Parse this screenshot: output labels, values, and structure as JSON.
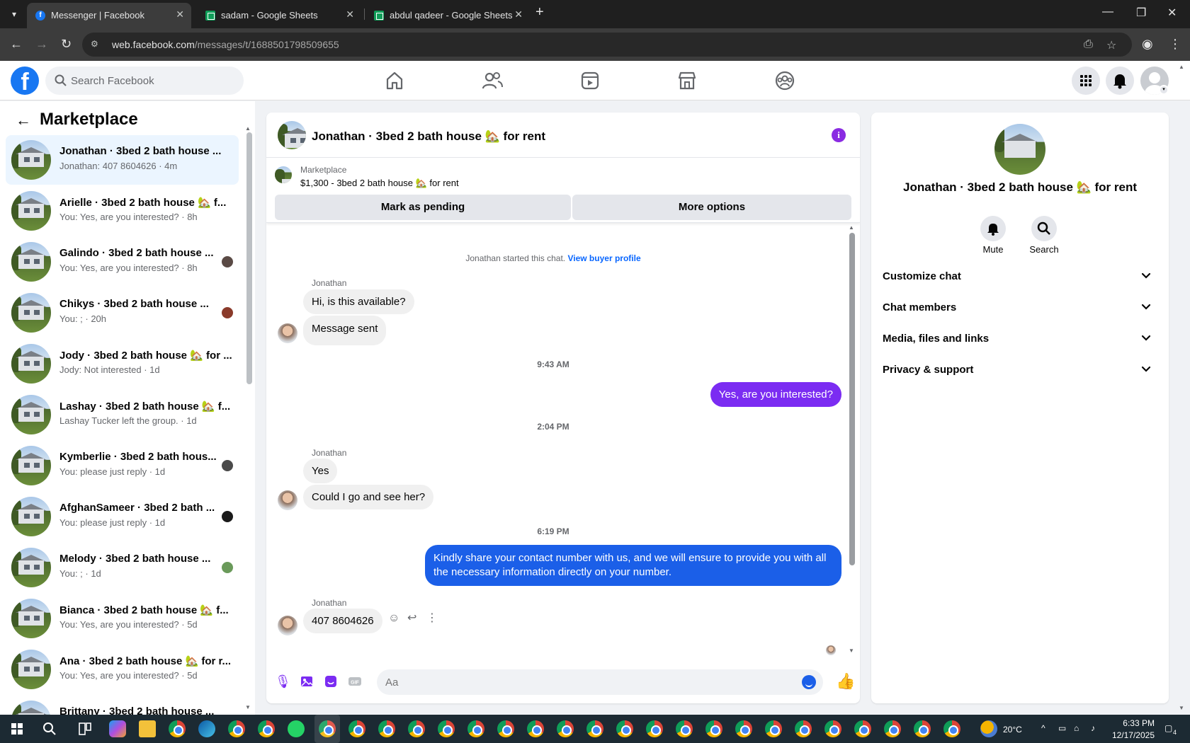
{
  "browser": {
    "tabs": [
      {
        "title": "Messenger | Facebook",
        "active": true
      },
      {
        "title": "sadam - Google Sheets",
        "active": false
      },
      {
        "title": "abdul qadeer - Google Sheets",
        "active": false
      }
    ],
    "url_host": "web.facebook.com",
    "url_path": "/messages/t/1688501798509655"
  },
  "header": {
    "search_placeholder": "Search Facebook"
  },
  "sidebar": {
    "title": "Marketplace",
    "conversations": [
      {
        "name": "Jonathan · 3bed 2 bath house ...",
        "preview": "Jonathan: 407 8604626 · 4m",
        "selected": true
      },
      {
        "name": "Arielle · 3bed 2 bath house 🏡 f...",
        "preview": "You: Yes, are you interested? · 8h"
      },
      {
        "name": "Galindo · 3bed 2 bath house ...",
        "preview": "You: Yes, are you interested? · 8h"
      },
      {
        "name": "Chikys · 3bed 2 bath house ...",
        "preview": "You: ; · 20h"
      },
      {
        "name": "Jody · 3bed 2 bath house 🏡 for ...",
        "preview": "Jody: Not interested · 1d"
      },
      {
        "name": "Lashay · 3bed 2 bath house 🏡 f...",
        "preview": "Lashay Tucker left the group. · 1d"
      },
      {
        "name": "Kymberlie · 3bed 2 bath hous...",
        "preview": "You: please just reply · 1d"
      },
      {
        "name": "AfghanSameer · 3bed 2 bath ...",
        "preview": "You: please just reply · 1d"
      },
      {
        "name": "Melody · 3bed 2 bath house ...",
        "preview": "You: ; · 1d"
      },
      {
        "name": "Bianca · 3bed 2 bath house 🏡 f...",
        "preview": "You: Yes, are you interested? · 5d"
      },
      {
        "name": "Ana · 3bed 2 bath house 🏡 for r...",
        "preview": "You: Yes, are you interested? · 5d"
      },
      {
        "name": "Brittany · 3bed 2 bath house ...",
        "preview": ""
      }
    ]
  },
  "chat": {
    "title": "Jonathan · 3bed 2 bath house 🏡 for rent",
    "listing_label": "Marketplace",
    "listing_text": "$1,300 - 3bed 2 bath house 🏡 for rent",
    "mark_pending": "Mark as pending",
    "more_options": "More options",
    "started_text": "Jonathan started this chat.",
    "view_buyer": "View buyer profile",
    "sender": "Jonathan",
    "msg1": "Hi, is this available?",
    "msg2": "Message sent",
    "time1": "9:43 AM",
    "out1": "Yes, are you interested?",
    "time2": "2:04 PM",
    "msg3": "Yes",
    "msg4": "Could I go and see her?",
    "time3": "6:19 PM",
    "out2": "Kindly share your contact number with us, and we will ensure to provide you with all the necessary information directly on your number.",
    "msg5": "407 8604626",
    "composer_placeholder": "Aa"
  },
  "details": {
    "title": "Jonathan · 3bed 2 bath house 🏡 for rent",
    "mute": "Mute",
    "search": "Search",
    "sections": [
      "Customize chat",
      "Chat members",
      "Media, files and links",
      "Privacy & support"
    ]
  },
  "taskbar": {
    "weather": "20°C",
    "time": "6:33 PM",
    "date": "12/17/2025",
    "notif_count": "4"
  },
  "colors": {
    "accent_purple": "#7b2cf2",
    "accent_blue": "#1b5fe8",
    "fb_blue": "#1877f2"
  }
}
